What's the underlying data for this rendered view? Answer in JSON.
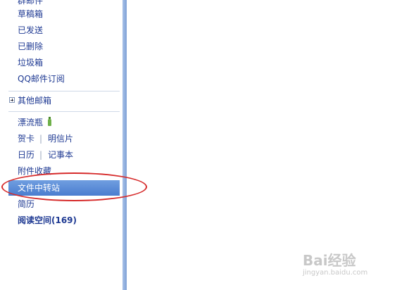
{
  "sidebar": {
    "items": [
      {
        "label": "群邮件"
      },
      {
        "label": "草稿箱"
      },
      {
        "label": "已发送"
      },
      {
        "label": "已删除"
      },
      {
        "label": "垃圾箱"
      },
      {
        "label": "QQ邮件订阅"
      }
    ],
    "other_mailboxes": "其他邮箱",
    "drift_bottle": "漂流瓶",
    "greeting_card": "贺卡",
    "postcard": "明信片",
    "calendar": "日历",
    "notebook": "记事本",
    "attachment_favorites": "附件收藏",
    "file_transfer": "文件中转站",
    "resume": "简历",
    "reading_space": "阅读空间(169)",
    "separator": "|"
  },
  "watermark": {
    "text": "Bai经验",
    "sub": "jingyan.baidu.com"
  },
  "colors": {
    "link": "#1f3a93",
    "selected_bg": "#4b7dcf",
    "annotation": "#d62a2a"
  }
}
